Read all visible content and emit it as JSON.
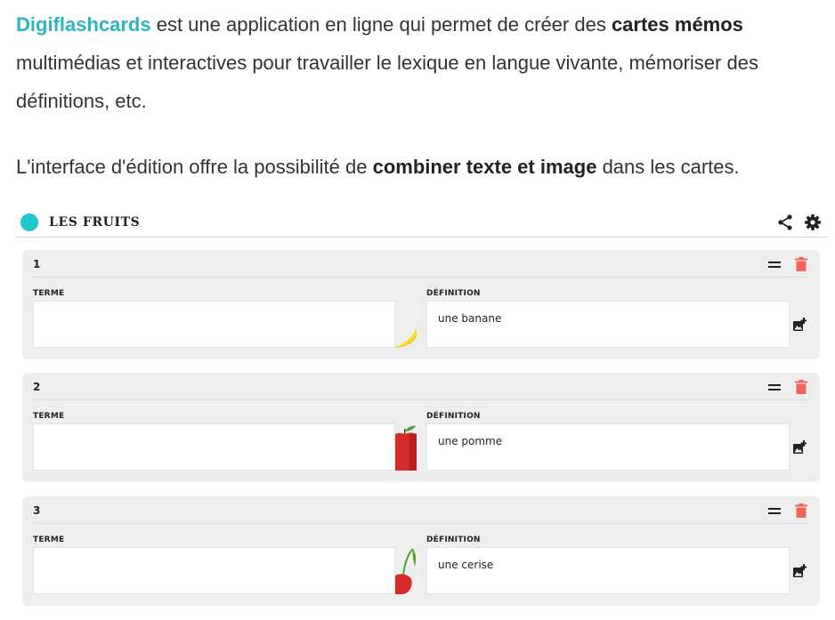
{
  "intro": {
    "p1_brand": "Digiflashcards",
    "p1_text_a": " est une application en ligne qui permet de créer des ",
    "p1_strong": "cartes mémos",
    "p1_text_b": " multimédias et interactives pour travailler le lexique en langue vivante, mémoriser des définitions, etc.",
    "p2_text_a": "L'interface d'édition offre la possibilité de ",
    "p2_strong": "combiner texte et image",
    "p2_text_b": " dans les cartes."
  },
  "app": {
    "title": "LES FRUITS",
    "accent": "#1fc7cf",
    "icons": [
      "share-icon",
      "gear-icon"
    ]
  },
  "cards": [
    {
      "number": "1",
      "term_label": "TERME",
      "term_value": "",
      "definition_label": "DÉFINITION",
      "definition_value": "une banane",
      "image": "banana"
    },
    {
      "number": "2",
      "term_label": "TERME",
      "term_value": "",
      "definition_label": "DÉFINITION",
      "definition_value": "une pomme",
      "image": "apple"
    },
    {
      "number": "3",
      "term_label": "TERME",
      "term_value": "",
      "definition_label": "DÉFINITION",
      "definition_value": "une cerise",
      "image": "cherry"
    }
  ],
  "colors": {
    "brand": "#29b6c1",
    "delete": "#f0645a",
    "card_bg": "#eeeeee"
  }
}
